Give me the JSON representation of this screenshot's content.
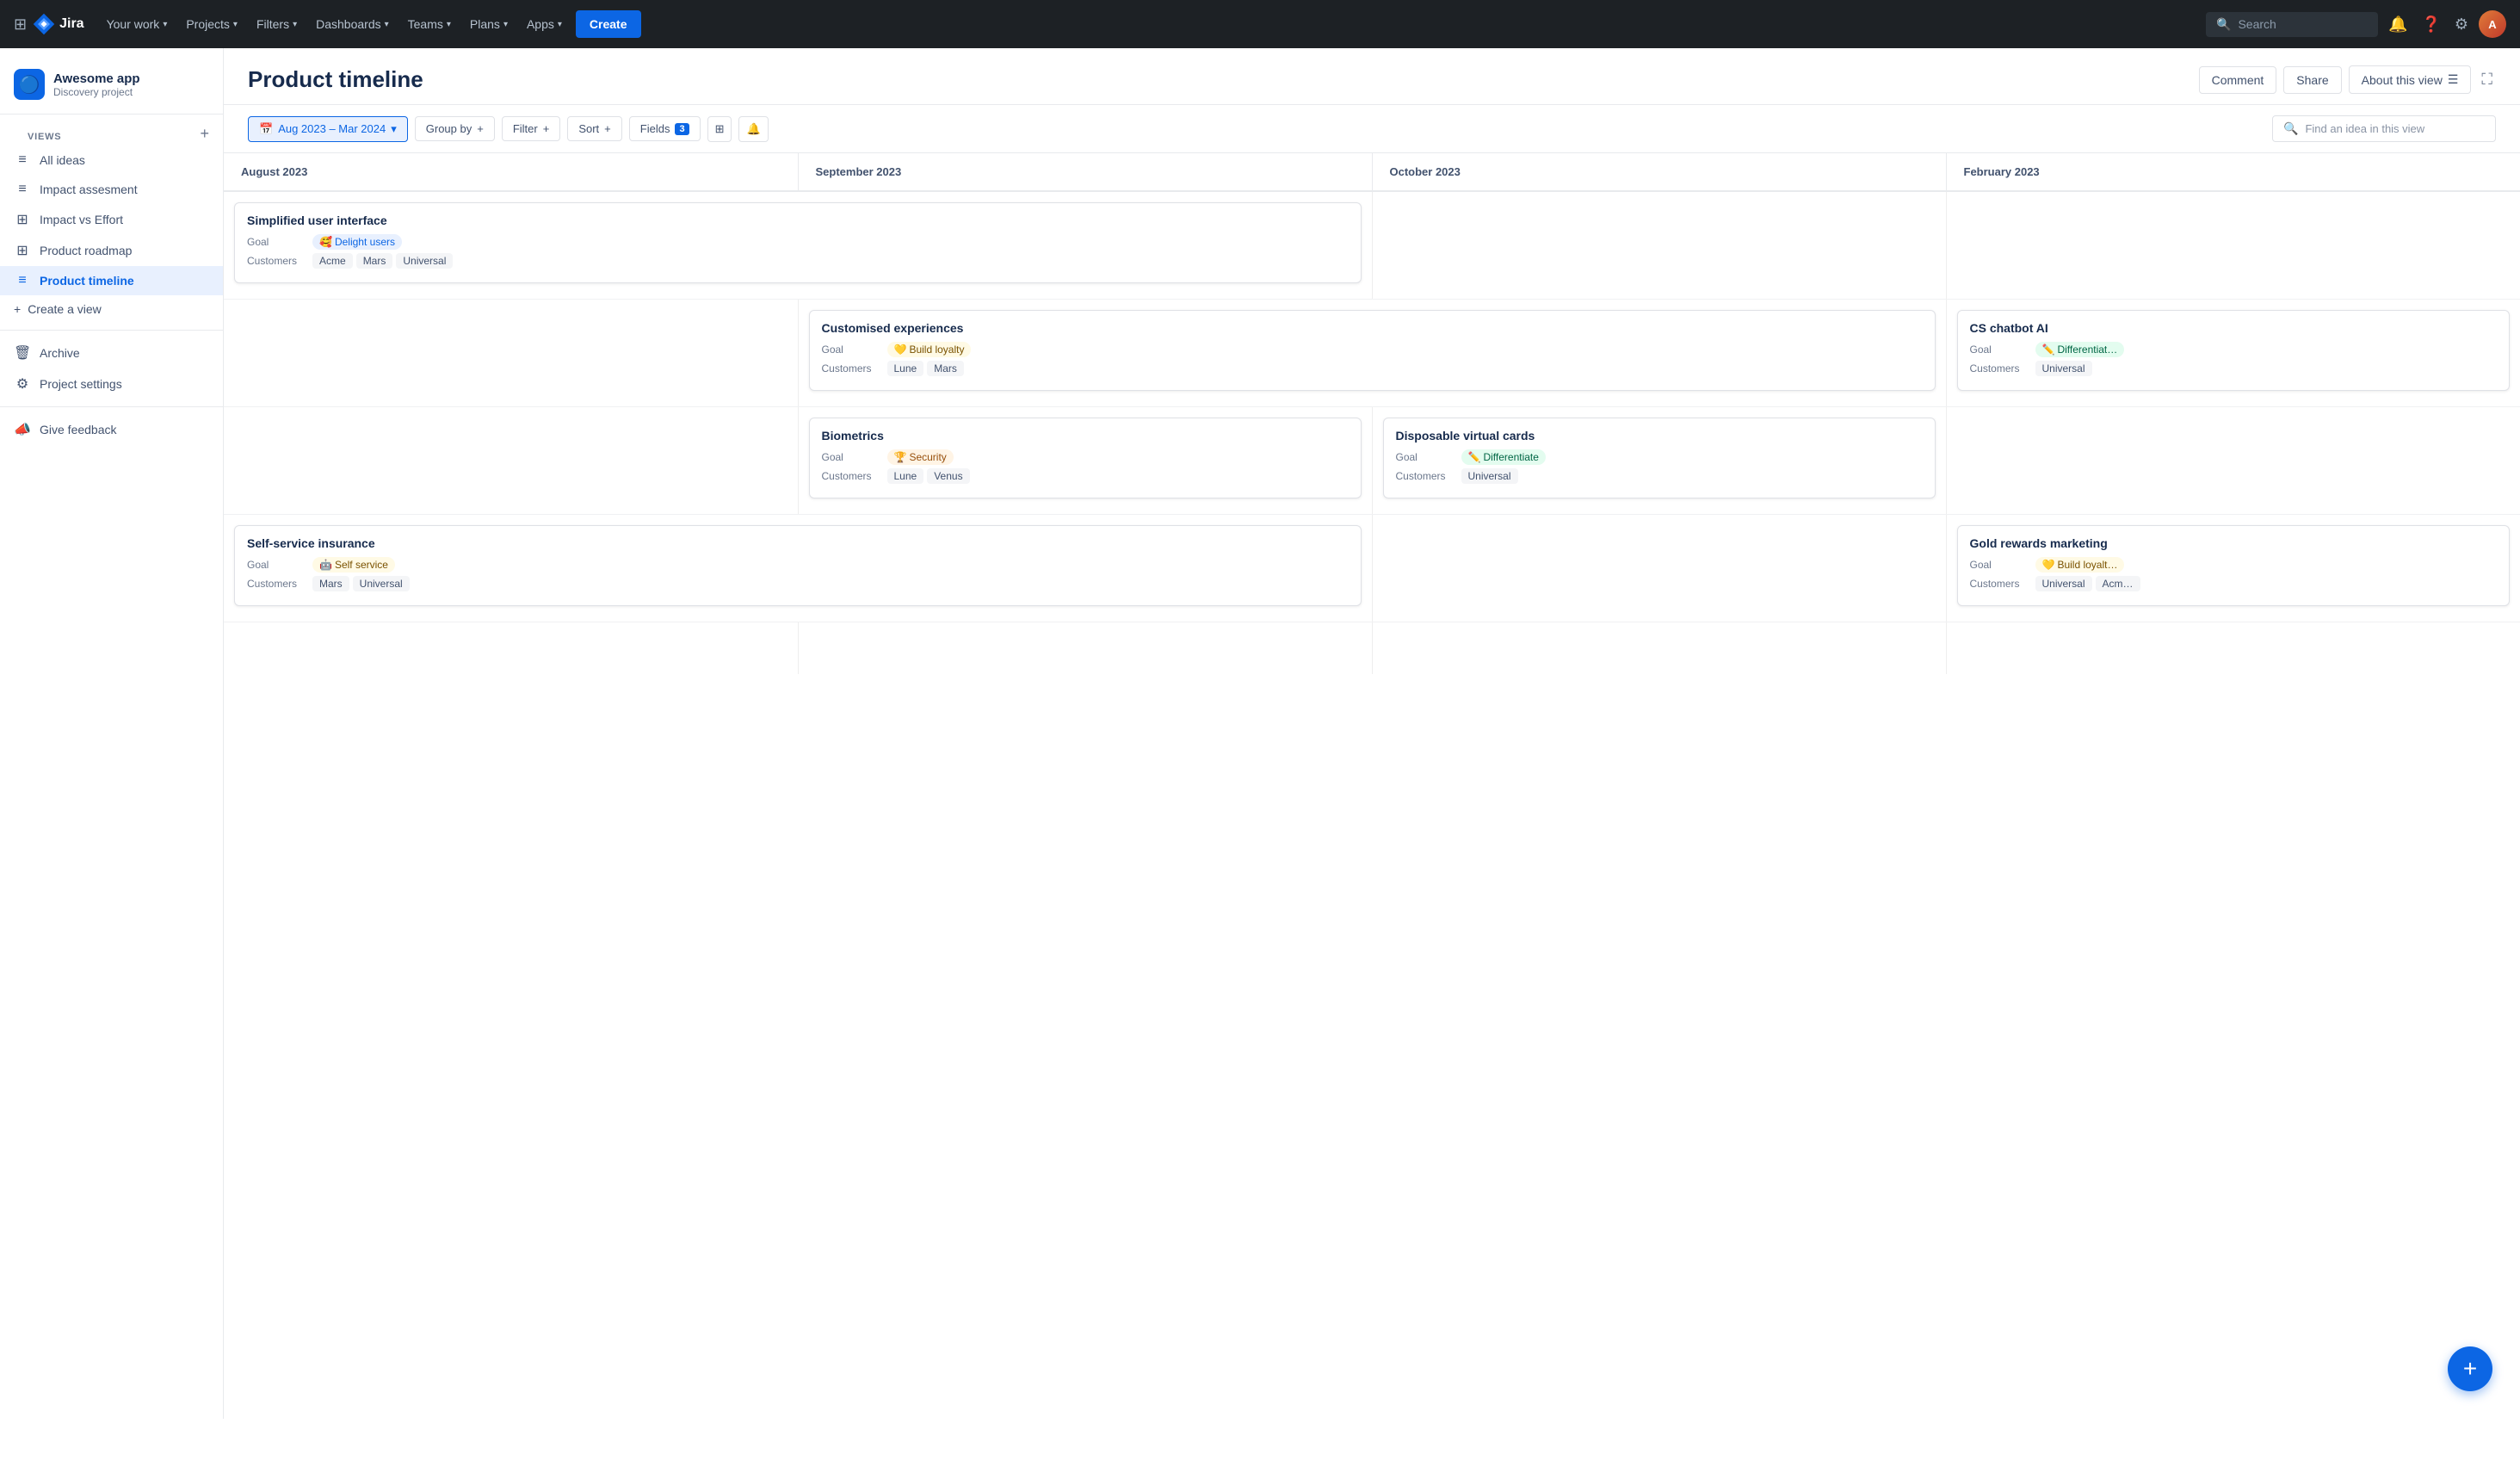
{
  "topnav": {
    "logo_text": "Jira",
    "nav_items": [
      {
        "label": "Your work",
        "id": "your-work",
        "has_chevron": true
      },
      {
        "label": "Projects",
        "id": "projects",
        "has_chevron": true
      },
      {
        "label": "Filters",
        "id": "filters",
        "has_chevron": true
      },
      {
        "label": "Dashboards",
        "id": "dashboards",
        "has_chevron": true
      },
      {
        "label": "Teams",
        "id": "teams",
        "has_chevron": true
      },
      {
        "label": "Plans",
        "id": "plans",
        "has_chevron": true
      },
      {
        "label": "Apps",
        "id": "apps",
        "has_chevron": true
      }
    ],
    "create_label": "Create",
    "search_placeholder": "Search"
  },
  "sidebar": {
    "project_name": "Awesome app",
    "project_sub": "Discovery project",
    "project_emoji": "🔷",
    "views_label": "VIEWS",
    "add_view_label": "+",
    "nav_items": [
      {
        "id": "all-ideas",
        "label": "All ideas",
        "icon": "≡"
      },
      {
        "id": "impact-assessment",
        "label": "Impact assesment",
        "icon": "≡"
      },
      {
        "id": "impact-effort",
        "label": "Impact vs Effort",
        "icon": "⊞"
      },
      {
        "id": "product-roadmap",
        "label": "Product roadmap",
        "icon": "⊞"
      },
      {
        "id": "product-timeline",
        "label": "Product timeline",
        "icon": "≡",
        "active": true
      }
    ],
    "create_view": {
      "label": "Create a view",
      "icon": "+"
    },
    "archive": {
      "label": "Archive",
      "icon": "🗑"
    },
    "project_settings": {
      "label": "Project settings",
      "icon": "⚙"
    },
    "give_feedback": {
      "label": "Give feedback",
      "icon": "📣"
    }
  },
  "page": {
    "title": "Product timeline",
    "actions": {
      "comment": "Comment",
      "share": "Share",
      "about": "About this view"
    }
  },
  "toolbar": {
    "date_range": "Aug 2023 – Mar 2024",
    "group_by": "Group by",
    "filter": "Filter",
    "sort": "Sort",
    "fields": "Fields",
    "fields_count": "3",
    "search_placeholder": "Find an idea in this view"
  },
  "timeline": {
    "months": [
      "August 2023",
      "September 2023",
      "October 2023",
      "February 2023"
    ],
    "rows": [
      {
        "cells": [
          {
            "card": {
              "title": "Simplified user interface",
              "goal_label": "Goal",
              "goal_emoji": "🥰",
              "goal_text": "Delight users",
              "goal_style": "blue",
              "customers_label": "Customers",
              "customers": [
                "Acme",
                "Mars",
                "Universal"
              ]
            },
            "span": 2
          },
          null,
          null,
          null
        ]
      },
      {
        "cells": [
          null,
          {
            "card": {
              "title": "Customised experiences",
              "goal_label": "Goal",
              "goal_emoji": "💛",
              "goal_text": "Build loyalty",
              "goal_style": "yellow",
              "customers_label": "Customers",
              "customers": [
                "Lune",
                "Mars"
              ]
            },
            "span": 2
          },
          null,
          {
            "card": {
              "title": "CS chatbot AI",
              "goal_label": "Goal",
              "goal_emoji": "✏️",
              "goal_text": "Differentiat…",
              "goal_style": "green",
              "customers_label": "Customers",
              "customers": [
                "Universal"
              ]
            },
            "span": 1
          }
        ]
      },
      {
        "cells": [
          null,
          {
            "card": {
              "title": "Biometrics",
              "goal_label": "Goal",
              "goal_emoji": "🏆",
              "goal_text": "Security",
              "goal_style": "orange",
              "customers_label": "Customers",
              "customers": [
                "Lune",
                "Venus"
              ]
            },
            "span": 1
          },
          {
            "card": {
              "title": "Disposable virtual cards",
              "goal_label": "Goal",
              "goal_emoji": "✏️",
              "goal_text": "Differentiate",
              "goal_style": "green",
              "customers_label": "Customers",
              "customers": [
                "Universal"
              ]
            },
            "span": 1
          },
          null
        ]
      },
      {
        "cells": [
          {
            "card": {
              "title": "Self-service insurance",
              "goal_label": "Goal",
              "goal_emoji": "🤖",
              "goal_text": "Self service",
              "goal_style": "yellow",
              "customers_label": "Customers",
              "customers": [
                "Mars",
                "Universal"
              ]
            },
            "span": 2
          },
          null,
          null,
          {
            "card": {
              "title": "Gold rewards marketing",
              "goal_label": "Goal",
              "goal_emoji": "💛",
              "goal_text": "Build loyalt…",
              "goal_style": "yellow",
              "customers_label": "Customers",
              "customers": [
                "Universal",
                "Acm…"
              ]
            },
            "span": 1
          }
        ]
      }
    ]
  },
  "fab": "+"
}
